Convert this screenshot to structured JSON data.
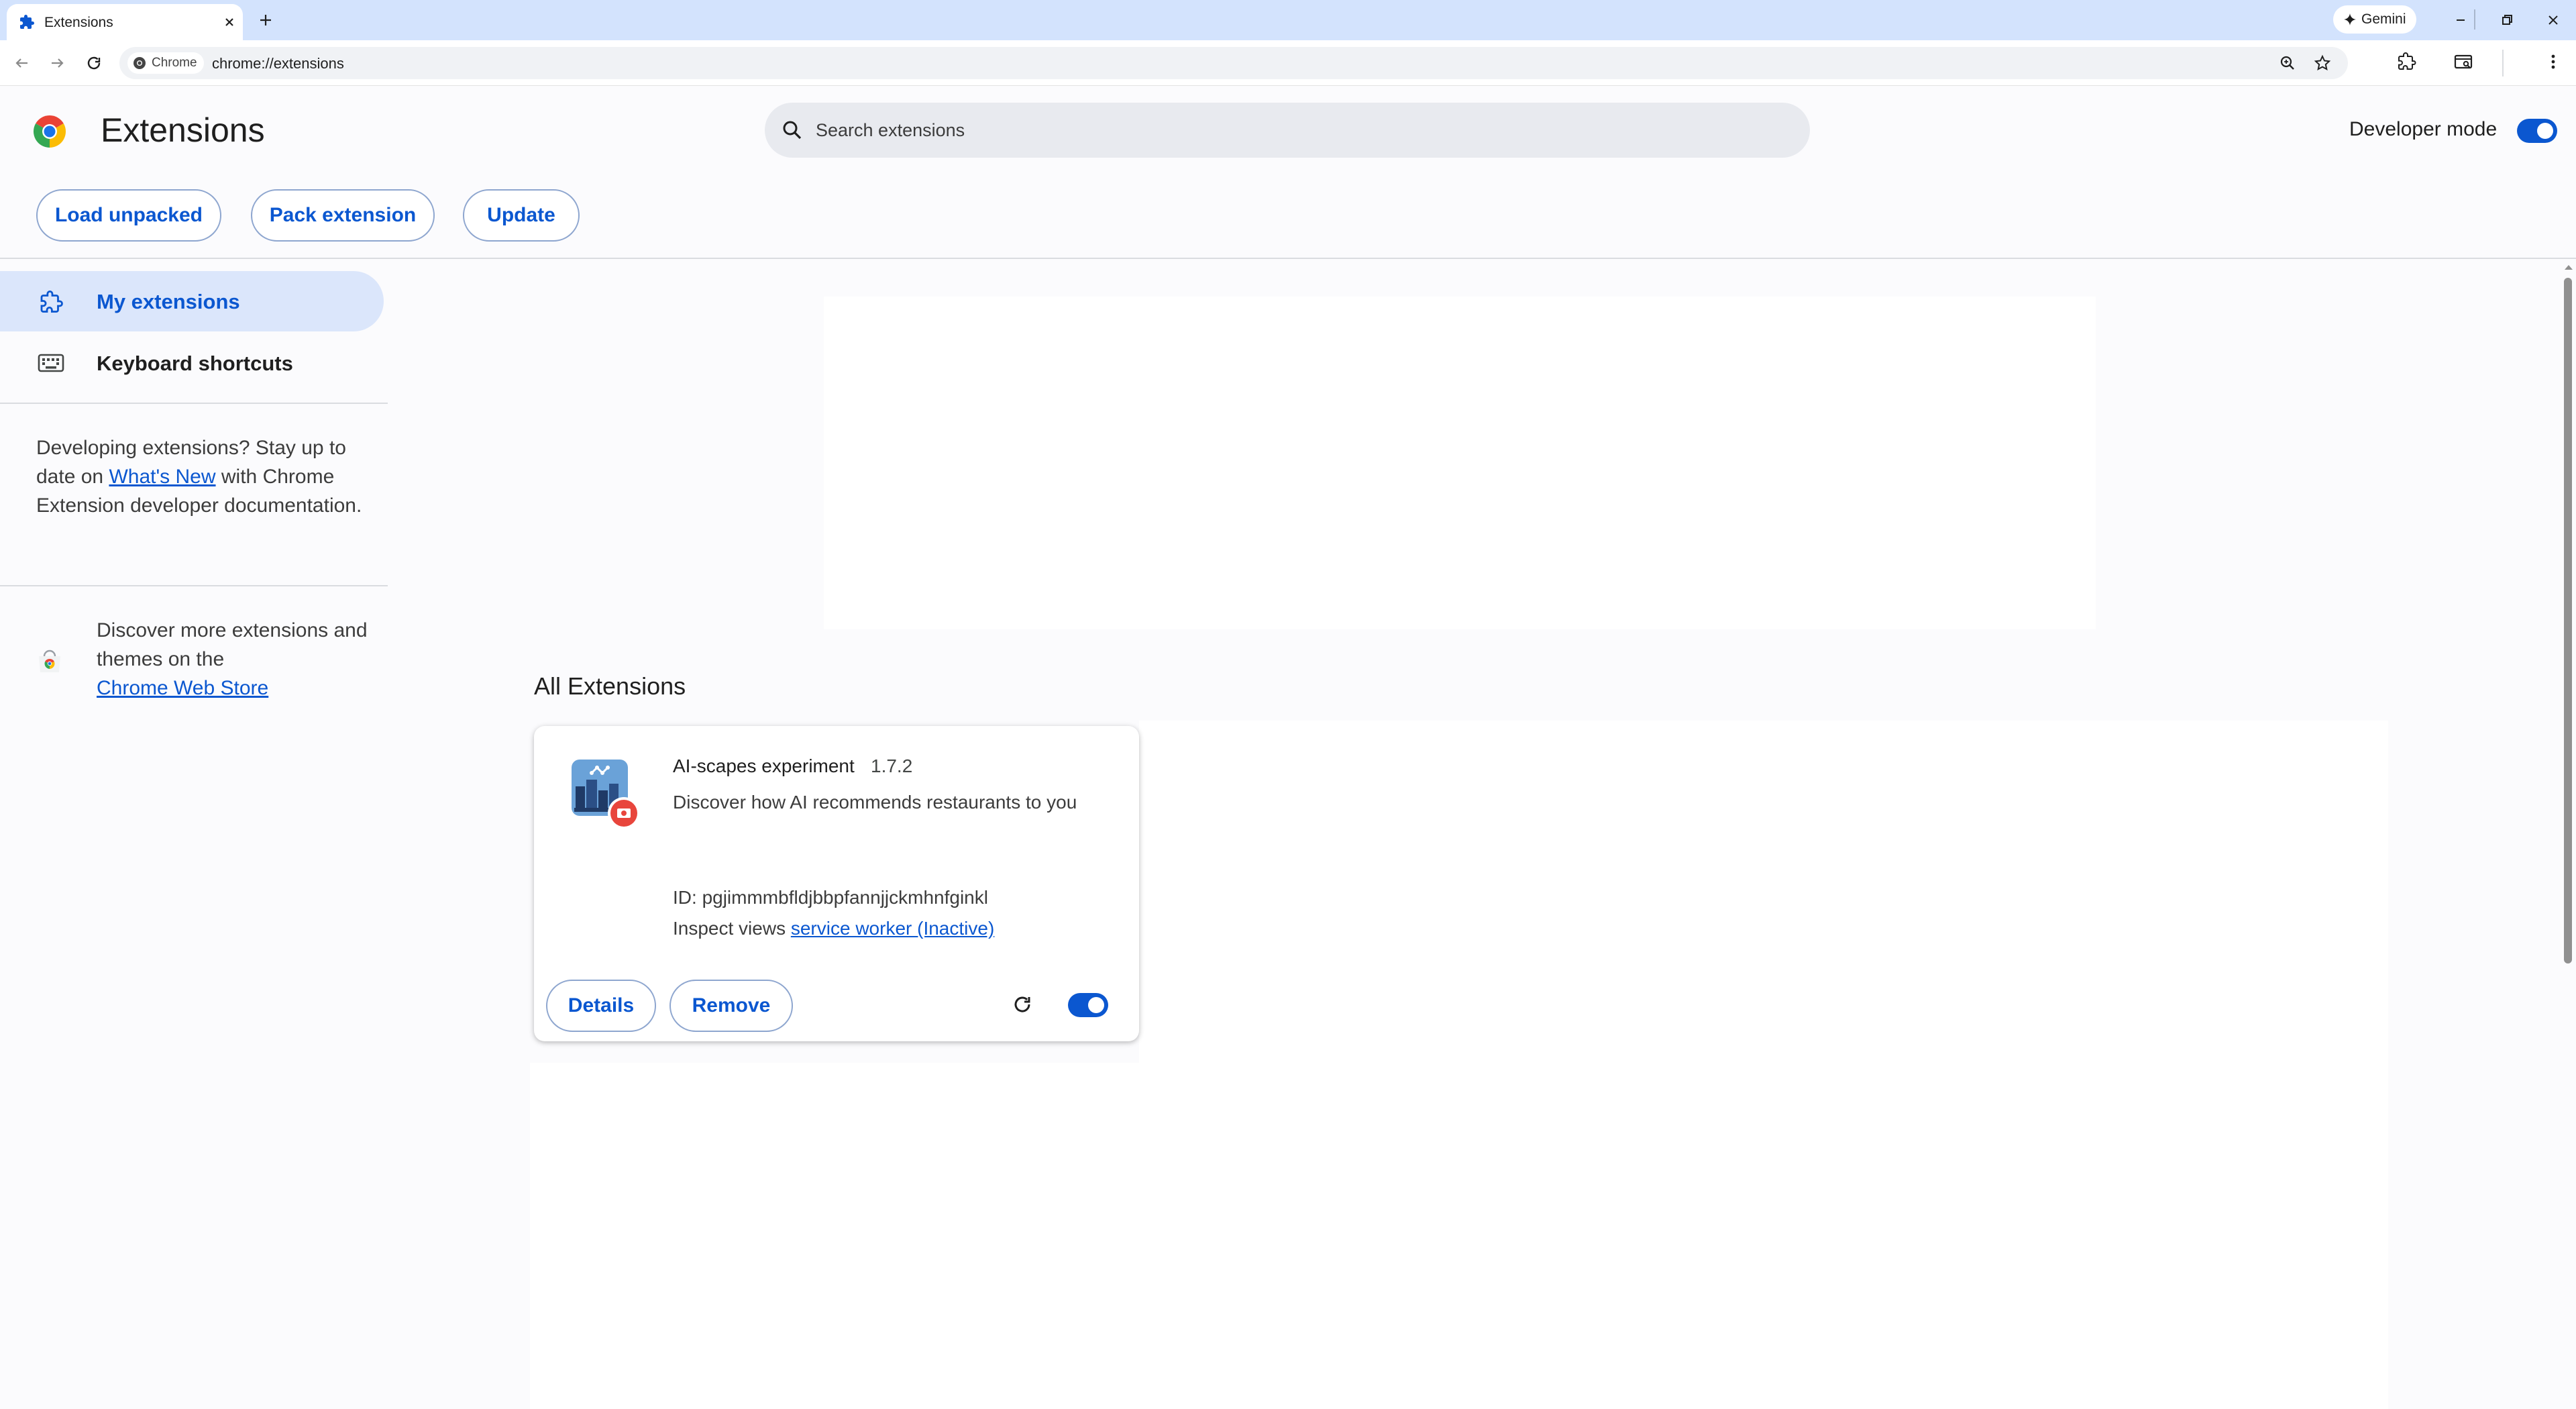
{
  "browser": {
    "tab_title": "Extensions",
    "gemini_label": "Gemini",
    "omnibox_chip": "Chrome",
    "url": "chrome://extensions"
  },
  "header": {
    "title": "Extensions",
    "search_placeholder": "Search extensions",
    "developer_mode_label": "Developer mode",
    "developer_mode_on": true
  },
  "dev_buttons": {
    "load_unpacked": "Load unpacked",
    "pack_extension": "Pack extension",
    "update": "Update"
  },
  "sidebar": {
    "items": [
      {
        "label": "My extensions",
        "selected": true
      },
      {
        "label": "Keyboard shortcuts",
        "selected": false
      }
    ],
    "dev_text_1": "Developing extensions? Stay up to date on",
    "dev_link": "What's New",
    "dev_text_2": "with Chrome Extension developer documentation.",
    "store_text": "Discover more extensions and themes on the",
    "store_link": "Chrome Web Store"
  },
  "main": {
    "section_title": "All Extensions",
    "extension": {
      "name": "AI-scapes experiment",
      "version": "1.7.2",
      "description": "Discover how AI recommends restaurants to you",
      "id_label": "ID:",
      "id_value": "pgjimmmbfldjbbpfannjjckmhnfginkl",
      "inspect_label": "Inspect views",
      "inspect_link": "service worker (Inactive)",
      "details_label": "Details",
      "remove_label": "Remove",
      "enabled": true
    }
  },
  "colors": {
    "accent": "#0b57d0",
    "tabstrip": "#d3e3fd",
    "selected_nav": "#dbe6fb"
  }
}
